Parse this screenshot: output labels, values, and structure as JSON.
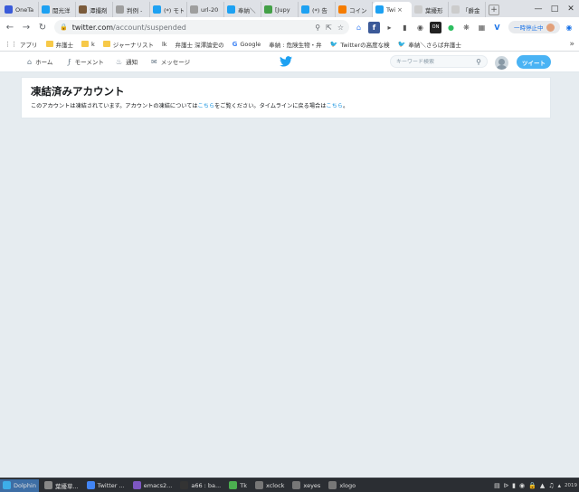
{
  "browser": {
    "tabs": [
      {
        "label": "OneTa",
        "color": "#3a5bd9",
        "active": false
      },
      {
        "label": "閲光洋",
        "color": "#1da1f2",
        "active": false
      },
      {
        "label": "潭撮剤",
        "color": "#7a5a3a",
        "active": false
      },
      {
        "label": "判例 -",
        "color": "#9e9e9e",
        "active": false
      },
      {
        "label": "(*) モト",
        "color": "#1da1f2",
        "active": false
      },
      {
        "label": "url-20",
        "color": "#9e9e9e",
        "active": false
      },
      {
        "label": "奉納＼",
        "color": "#1da1f2",
        "active": false
      },
      {
        "label": "[Jupy",
        "color": "#43a047",
        "active": false
      },
      {
        "label": "(*) 告",
        "color": "#1da1f2",
        "active": false
      },
      {
        "label": "コイン",
        "color": "#f57c00",
        "active": false
      },
      {
        "label": "Twi",
        "color": "#1da1f2",
        "active": true
      },
      {
        "label": "葉擾形",
        "color": "#cccccc",
        "active": false
      },
      {
        "label": "「爵金",
        "color": "#cccccc",
        "active": false
      }
    ],
    "new_tab_label": "+",
    "window_buttons": [
      "—",
      "□",
      "✕"
    ],
    "url_host": "twitter.com",
    "url_path": "/account/suspended",
    "pause_label": "一時停止中"
  },
  "bookmarks": [
    {
      "label": "アプリ",
      "kind": "grid"
    },
    {
      "label": "弁護士",
      "kind": "folder"
    },
    {
      "label": "k",
      "kind": "folder"
    },
    {
      "label": "ジャーナリスト",
      "kind": "folder"
    },
    {
      "label": "lk",
      "kind": "page"
    },
    {
      "label": "弁護士 深澤論史の",
      "kind": "page"
    },
    {
      "label": "Google",
      "kind": "g"
    },
    {
      "label": "奉納 : 危険生物・弁",
      "kind": "page"
    },
    {
      "label": "Twitterの高度な検",
      "kind": "tw"
    },
    {
      "label": "奉納＼さらば弁護士",
      "kind": "tw"
    }
  ],
  "twitter": {
    "nav": {
      "home": "ホーム",
      "moments": "モーメント",
      "notifications": "通知",
      "messages": "メッセージ"
    },
    "search_placeholder": "キーワード検索",
    "tweet_button": "ツイート",
    "suspended": {
      "title": "凍結済みアカウント",
      "text_before": "このアカウントは凍結されています。アカウントの凍結については",
      "link1": "こちら",
      "text_middle": "をご覧ください。タイムラインに戻る場合は",
      "link2": "こちら",
      "text_after": "。"
    }
  },
  "taskbar": {
    "tasks": [
      {
        "label": "Dolphin",
        "active": true,
        "color": "#3daee9"
      },
      {
        "label": "葉擾草...",
        "active": false,
        "color": "#888888"
      },
      {
        "label": "Twitter ...",
        "active": false,
        "color": "#4285f4"
      },
      {
        "label": "emacs2...",
        "active": false,
        "color": "#7e57c2"
      },
      {
        "label": "a66 : ba...",
        "active": false,
        "color": "#333333"
      },
      {
        "label": "Tk",
        "active": false,
        "color": "#4caf50"
      },
      {
        "label": "xclock",
        "active": false,
        "color": "#777777"
      },
      {
        "label": "xeyes",
        "active": false,
        "color": "#777777"
      },
      {
        "label": "xlogo",
        "active": false,
        "color": "#777777"
      }
    ],
    "clock": "2019"
  },
  "colors": {
    "twitter_blue": "#1da1f2",
    "tweet_button": "#4ab3f4",
    "link": "#1b95e0",
    "page_bg": "#e6ecf0"
  }
}
